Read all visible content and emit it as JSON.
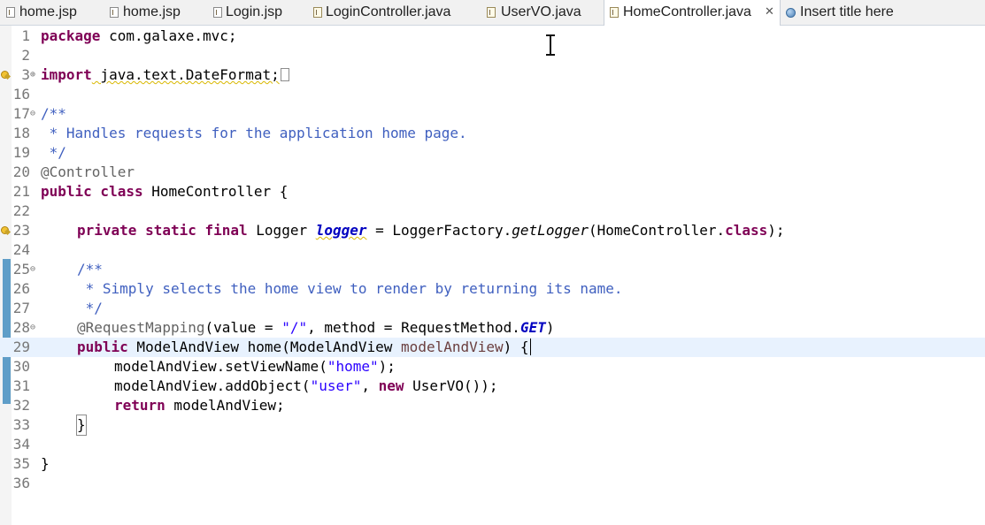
{
  "tabs": [
    {
      "label": "home.jsp",
      "icon": "jsp-file-icon"
    },
    {
      "label": "home.jsp",
      "icon": "jsp-file-icon"
    },
    {
      "label": "Login.jsp",
      "icon": "jsp-file-icon"
    },
    {
      "label": "LoginController.java",
      "icon": "java-file-icon"
    },
    {
      "label": "UserVO.java",
      "icon": "java-file-icon"
    },
    {
      "label": "HomeController.java",
      "icon": "java-file-icon",
      "active": true,
      "close": "✕"
    },
    {
      "label": "Insert title here",
      "icon": "browser-globe-icon"
    }
  ],
  "editor": {
    "line_numbers": [
      "1",
      "2",
      "3",
      "16",
      "17",
      "18",
      "19",
      "20",
      "21",
      "22",
      "23",
      "24",
      "25",
      "26",
      "27",
      "28",
      "29",
      "30",
      "31",
      "32",
      "33",
      "34",
      "35",
      "36"
    ],
    "code": {
      "l1_kw": "package",
      "l1_rest": " com.galaxe.mvc;",
      "l3_kw": "import",
      "l3_rest": " java.text.DateFormat;",
      "l17": "/**",
      "l18": " * Handles requests for the application home page.",
      "l19": " */",
      "l20": "@Controller",
      "l21_kw": "public class",
      "l21_rest": " HomeController {",
      "l23_kw": "private static final",
      "l23_a": " Logger ",
      "l23_field": "logger",
      "l23_b": " = LoggerFactory.",
      "l23_method": "getLogger",
      "l23_c": "(HomeController.",
      "l23_kw2": "class",
      "l23_d": ");",
      "l25": "/**",
      "l26": " * Simply selects the home view to render by returning its name.",
      "l27": " */",
      "l28_an": "@RequestMapping",
      "l28_a": "(value = ",
      "l28_str": "\"/\"",
      "l28_b": ", method = RequestMethod.",
      "l28_const": "GET",
      "l28_c": ")",
      "l29_kw": "public",
      "l29_a": " ModelAndView home(ModelAndView ",
      "l29_var": "modelAndView",
      "l29_b": ") {",
      "l30_a": "modelAndView.setViewName(",
      "l30_str": "\"home\"",
      "l30_b": ");",
      "l31_a": "modelAndView.addObject(",
      "l31_str": "\"user\"",
      "l31_b": ", ",
      "l31_kw": "new",
      "l31_c": " UserVO());",
      "l32_kw": "return",
      "l32_a": " modelAndView;",
      "l33": "}",
      "l35": "}"
    }
  },
  "colors": {
    "keyword": "#7f0055",
    "comment": "#3f5fbf",
    "string": "#2a00ff",
    "annotation": "#646464",
    "field": "#0000c0",
    "current_line": "#e8f2fe",
    "change_bar": "#5f9ec8"
  }
}
